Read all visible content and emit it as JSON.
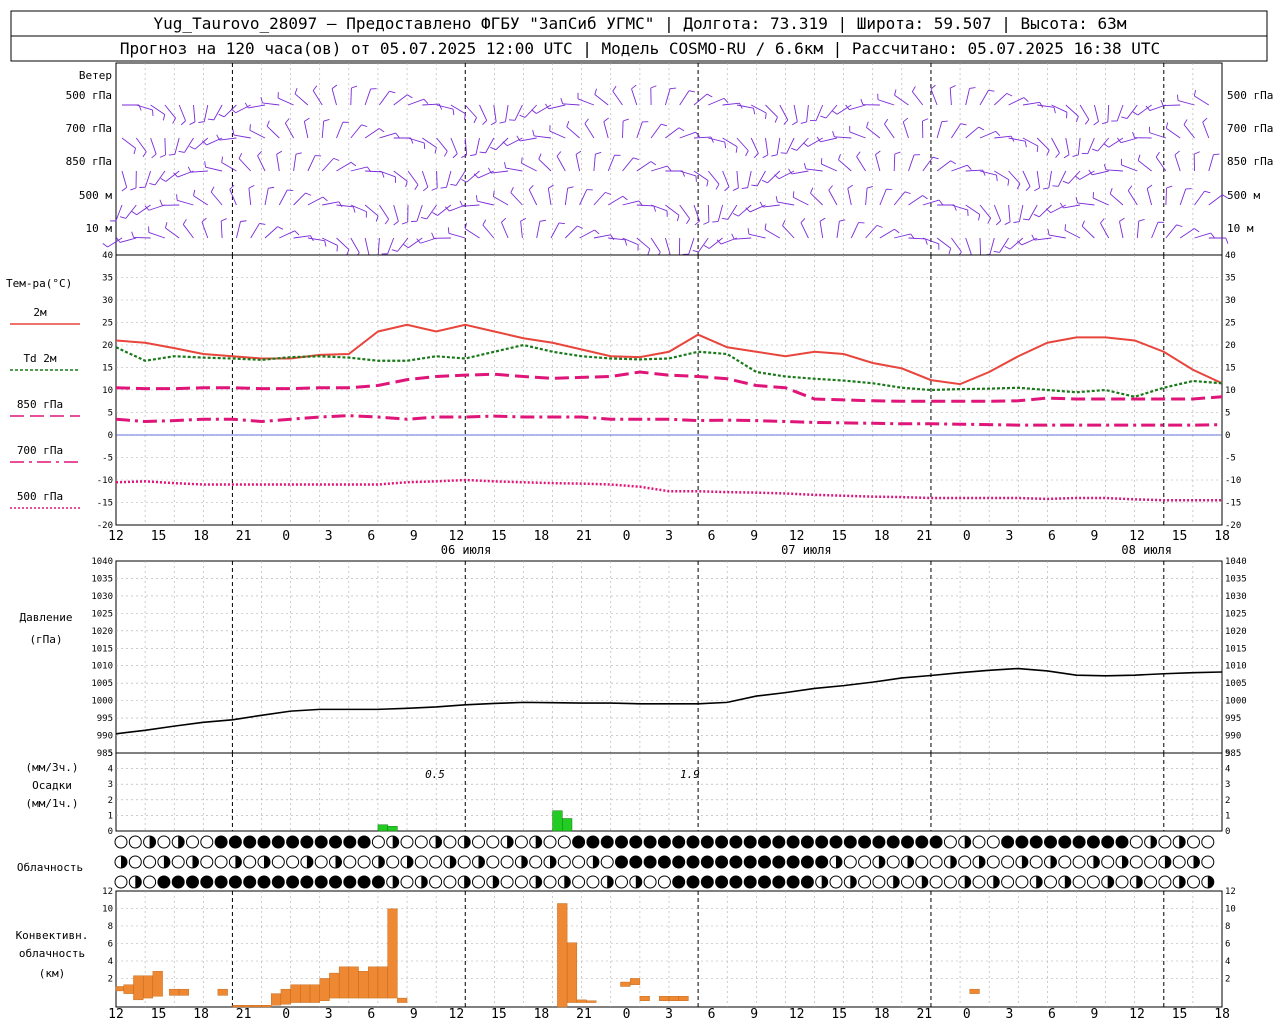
{
  "header": {
    "line1": "Yug_Taurovo_28097 – Предоставлено ФГБУ \"ЗапСиб УГМС\" | Долгота: 73.319 | Широта: 59.507 | Высота: 63м",
    "line2": "Прогноз на 120 часа(ов) от 05.07.2025 12:00 UTC  | Модель COSMO-RU / 6.6км | Рассчитано: 05.07.2025 16:38 UTC"
  },
  "wind_panel": {
    "title": "Ветер",
    "levels": [
      "500 гПа",
      "700 гПа",
      "850 гПа",
      "500 м",
      "10 м"
    ]
  },
  "temp_panel": {
    "title": "Тем-ра(°C)",
    "legend": [
      {
        "label": "2м",
        "color": "#e8453c",
        "style": "solid"
      },
      {
        "label": "Td 2м",
        "color": "#1a7a1a",
        "style": "dotted"
      },
      {
        "label": "850 гПа",
        "color": "#e0157a",
        "style": "dash"
      },
      {
        "label": "700 гПа",
        "color": "#e0157a",
        "style": "dashdot"
      },
      {
        "label": "500 гПа",
        "color": "#e0157a",
        "style": "dot"
      }
    ]
  },
  "pressure_panel": {
    "title": "Давление",
    "unit": "(гПа)"
  },
  "precip_panel": {
    "unit_top": "(мм/3ч.)",
    "title": "Осадки",
    "unit_bottom": "(мм/1ч.)",
    "annotations": [
      "0.5",
      "1.9"
    ]
  },
  "cloud_panel": {
    "title": "Облачность"
  },
  "conv_panel": {
    "title_line1": "Конвективн.",
    "title_line2": "облачность",
    "unit": "(км)"
  },
  "x_axis": {
    "hour_labels": [
      "12",
      "15",
      "18",
      "21",
      "0",
      "3",
      "6",
      "9",
      "12",
      "15",
      "18",
      "21",
      "0",
      "3",
      "6",
      "9",
      "12",
      "15",
      "18",
      "21",
      "0",
      "3",
      "6",
      "9",
      "12",
      "15",
      "18"
    ],
    "date_labels": [
      "06 июля",
      "07 июля",
      "08 июля"
    ]
  },
  "colors": {
    "wind": "#7a2ad8",
    "t2m": "#e8453c",
    "td": "#1a7a1a",
    "upper": "#e0157a",
    "pressure": "#000000",
    "precip": "#22cc22",
    "conv": "#ee8833",
    "zero": "#3344cc"
  },
  "chart_data": [
    {
      "type": "line",
      "title": "Тем-ра(°C)",
      "x_hours": [
        0,
        3,
        6,
        9,
        12,
        15,
        18,
        21,
        24,
        27,
        30,
        33,
        36,
        39,
        42,
        45,
        48,
        51,
        54,
        57,
        60,
        63,
        66,
        69,
        72,
        75,
        78,
        81,
        84,
        87,
        90,
        93,
        96,
        99,
        102,
        105,
        108,
        111,
        114
      ],
      "ylim": [
        -20,
        40
      ],
      "series": [
        {
          "name": "2м",
          "values": [
            21,
            20.5,
            19.3,
            18,
            17.5,
            17,
            17,
            17.8,
            18,
            23,
            24.5,
            23,
            24.5,
            23,
            21.5,
            20.5,
            19,
            17.5,
            17.3,
            18.5,
            22.3,
            19.5,
            18.5,
            17.5,
            18.5,
            18,
            16,
            14.8,
            12.2,
            11.3,
            14,
            17.5,
            20.5,
            21.7,
            21.7,
            21,
            18.5,
            14.5,
            11.5
          ]
        },
        {
          "name": "Td 2м",
          "values": [
            19.5,
            16.5,
            17.5,
            17.2,
            17,
            16.7,
            17.3,
            17.5,
            17.2,
            16.5,
            16.5,
            17.5,
            17,
            18.5,
            20,
            18.5,
            17.5,
            17,
            16.8,
            17,
            18.5,
            18,
            14,
            13,
            12.5,
            12.1,
            11.5,
            10.5,
            10,
            10.2,
            10.3,
            10.5,
            10,
            9.5,
            10,
            8.5,
            10.5,
            12,
            11.5
          ]
        },
        {
          "name": "850 гПа",
          "values": [
            10.5,
            10.3,
            10.3,
            10.5,
            10.5,
            10.3,
            10.3,
            10.5,
            10.5,
            11,
            12.3,
            13,
            13.3,
            13.5,
            13,
            12.6,
            12.8,
            13,
            14,
            13.3,
            13,
            12.5,
            11,
            10.5,
            8,
            7.8,
            7.6,
            7.5,
            7.5,
            7.5,
            7.5,
            7.6,
            8.2,
            8,
            8,
            8,
            8,
            8,
            8.5
          ]
        },
        {
          "name": "700 гПа",
          "values": [
            3.5,
            3,
            3.2,
            3.5,
            3.5,
            3,
            3.5,
            4,
            4.3,
            4,
            3.5,
            4,
            4,
            4.2,
            4,
            4,
            4,
            3.5,
            3.5,
            3.5,
            3.2,
            3.3,
            3.2,
            3,
            2.8,
            2.7,
            2.6,
            2.5,
            2.5,
            2.4,
            2.3,
            2.2,
            2.2,
            2.2,
            2.2,
            2.2,
            2.2,
            2.2,
            2.3
          ]
        },
        {
          "name": "500 гПа",
          "values": [
            -10.5,
            -10.3,
            -10.7,
            -11,
            -11,
            -11,
            -11,
            -11,
            -11,
            -11,
            -10.5,
            -10.3,
            -10,
            -10.3,
            -10.5,
            -10.7,
            -10.8,
            -11,
            -11.5,
            -12.5,
            -12.5,
            -12.7,
            -12.8,
            -13,
            -13.3,
            -13.5,
            -13.7,
            -13.8,
            -14,
            -14,
            -14,
            -14,
            -14.2,
            -14,
            -14,
            -14.3,
            -14.5,
            -14.5,
            -14.5
          ]
        }
      ]
    },
    {
      "type": "line",
      "title": "Давление",
      "x_hours": [
        0,
        3,
        6,
        9,
        12,
        15,
        18,
        21,
        24,
        27,
        30,
        33,
        36,
        39,
        42,
        45,
        48,
        51,
        54,
        57,
        60,
        63,
        66,
        69,
        72,
        75,
        78,
        81,
        84,
        87,
        90,
        93,
        96,
        99,
        102,
        105,
        108,
        111,
        114
      ],
      "ylim": [
        985,
        1040
      ],
      "series": [
        {
          "name": "Давление",
          "values": [
            990.5,
            991.5,
            992.7,
            993.8,
            994.5,
            995.8,
            997,
            997.5,
            997.5,
            997.5,
            997.8,
            998.2,
            998.8,
            999.2,
            999.5,
            999.4,
            999.3,
            999.3,
            999.1,
            999.1,
            999.1,
            999.5,
            1001.3,
            1002.3,
            1003.5,
            1004.3,
            1005.3,
            1006.5,
            1007.2,
            1008,
            1008.7,
            1009.2,
            1008.5,
            1007.3,
            1007.1,
            1007.3,
            1007.7,
            1008,
            1008.2
          ]
        }
      ]
    },
    {
      "type": "bar",
      "title": "Осадки",
      "ylim": [
        0,
        5
      ],
      "bars": [
        {
          "x": 27,
          "w": 1,
          "h": 0.4
        },
        {
          "x": 28,
          "w": 1,
          "h": 0.3
        },
        {
          "x": 45,
          "w": 1,
          "h": 1.3
        },
        {
          "x": 46,
          "w": 1,
          "h": 0.8
        }
      ]
    },
    {
      "type": "bar",
      "title": "Конвективн. облачность",
      "ylim": [
        0,
        13
      ],
      "bars": [
        {
          "x": 0,
          "w": 0.8,
          "b": 1.8,
          "t": 2.3
        },
        {
          "x": 0.8,
          "w": 1,
          "b": 1.5,
          "t": 2.5
        },
        {
          "x": 1.8,
          "w": 1,
          "b": 0.8,
          "t": 3.5
        },
        {
          "x": 2.8,
          "w": 1,
          "b": 1,
          "t": 3.5
        },
        {
          "x": 3.8,
          "w": 1,
          "b": 1.2,
          "t": 4
        },
        {
          "x": 5.5,
          "w": 1,
          "b": 1.3,
          "t": 2
        },
        {
          "x": 6.5,
          "w": 1,
          "b": 1.3,
          "t": 2
        },
        {
          "x": 10.5,
          "w": 1,
          "b": 1.3,
          "t": 2
        },
        {
          "x": 12,
          "w": 1,
          "b": 0,
          "t": 0.2
        },
        {
          "x": 13,
          "w": 1,
          "b": 0,
          "t": 0.2
        },
        {
          "x": 14,
          "w": 1,
          "b": 0,
          "t": 0.2
        },
        {
          "x": 15,
          "w": 1,
          "b": 0,
          "t": 0.2
        },
        {
          "x": 16,
          "w": 1,
          "b": 0.2,
          "t": 1.5
        },
        {
          "x": 17,
          "w": 1,
          "b": 0.3,
          "t": 2
        },
        {
          "x": 18,
          "w": 1,
          "b": 0.5,
          "t": 2.5
        },
        {
          "x": 19,
          "w": 1,
          "b": 0.5,
          "t": 2.5
        },
        {
          "x": 20,
          "w": 1,
          "b": 0.5,
          "t": 2.5
        },
        {
          "x": 21,
          "w": 1,
          "b": 0.7,
          "t": 3.2
        },
        {
          "x": 22,
          "w": 1,
          "b": 1,
          "t": 3.8
        },
        {
          "x": 23,
          "w": 1,
          "b": 1,
          "t": 4.5
        },
        {
          "x": 24,
          "w": 1,
          "b": 1,
          "t": 4.5
        },
        {
          "x": 25,
          "w": 1,
          "b": 1,
          "t": 4
        },
        {
          "x": 26,
          "w": 1,
          "b": 1,
          "t": 4.5
        },
        {
          "x": 27,
          "w": 1,
          "b": 1,
          "t": 4.5
        },
        {
          "x": 28,
          "w": 1,
          "b": 1,
          "t": 11
        },
        {
          "x": 29,
          "w": 1,
          "b": 0.5,
          "t": 1
        },
        {
          "x": 45.5,
          "w": 1,
          "b": 0,
          "t": 11.6
        },
        {
          "x": 46.5,
          "w": 1,
          "b": 0.5,
          "t": 7.2
        },
        {
          "x": 47.5,
          "w": 1,
          "b": 0.5,
          "t": 0.8
        },
        {
          "x": 48.5,
          "w": 1,
          "b": 0.5,
          "t": 0.7
        },
        {
          "x": 52,
          "w": 1,
          "b": 2.3,
          "t": 2.8
        },
        {
          "x": 53,
          "w": 1,
          "b": 2.5,
          "t": 3.2
        },
        {
          "x": 54,
          "w": 1,
          "b": 0.7,
          "t": 1.2
        },
        {
          "x": 56,
          "w": 1,
          "b": 0.7,
          "t": 1.2
        },
        {
          "x": 57,
          "w": 1,
          "b": 0.7,
          "t": 1.2
        },
        {
          "x": 58,
          "w": 1,
          "b": 0.7,
          "t": 1.2
        },
        {
          "x": 88,
          "w": 1,
          "b": 1.5,
          "t": 2
        }
      ]
    }
  ]
}
